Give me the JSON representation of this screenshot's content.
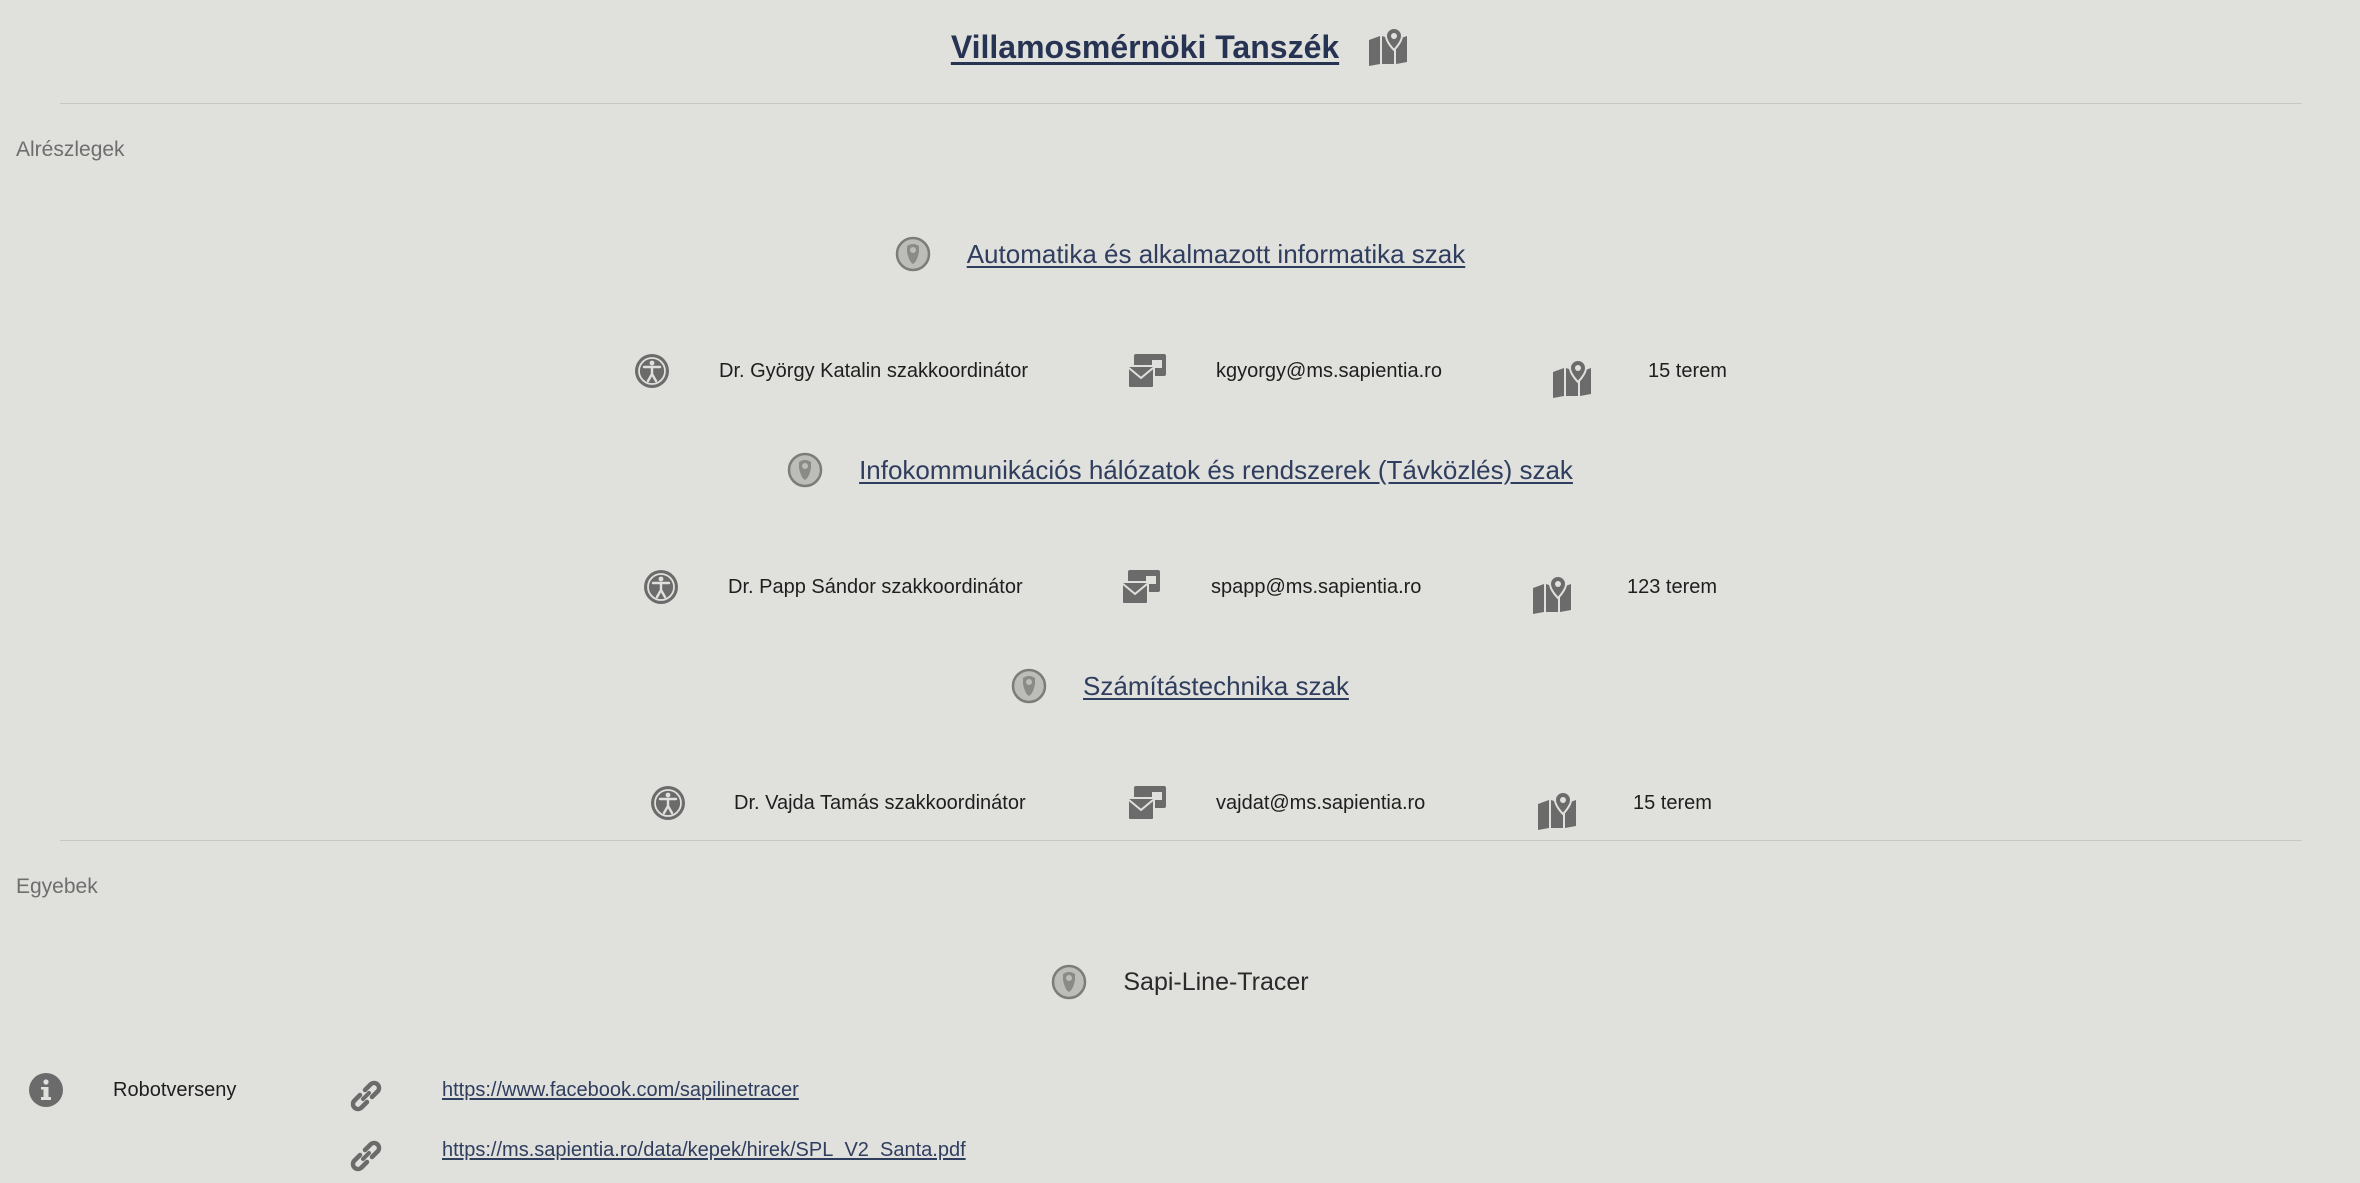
{
  "header": {
    "title": "Villamosmérnöki Tanszék",
    "map_icon": "map-location-icon"
  },
  "sections": {
    "subunits_label": "Alrészlegek",
    "other_label": "Egyebek"
  },
  "programs": [
    {
      "name": "Automatika és alkalmazott informatika szak",
      "coordinator": "Dr. György Katalin szakkoordinátor",
      "email": "kgyorgy@ms.sapientia.ro",
      "room": "15 terem"
    },
    {
      "name": "Infokommunikációs hálózatok és rendszerek (Távközlés) szak",
      "coordinator": "Dr. Papp Sándor szakkoordinátor",
      "email": "spapp@ms.sapientia.ro",
      "room": "123 terem"
    },
    {
      "name": "Számítástechnika szak",
      "coordinator": "Dr. Vajda Tamás szakkoordinátor",
      "email": "vajdat@ms.sapientia.ro",
      "room": "15 terem"
    }
  ],
  "other": {
    "title": "Sapi-Line-Tracer",
    "description": "Robotverseny",
    "links": [
      "https://www.facebook.com/sapilinetracer",
      "https://ms.sapientia.ro/data/kepek/hirek/SPL_V2_Santa.pdf"
    ]
  },
  "colors": {
    "background": "#e0e0dc",
    "link": "#2f3d5e",
    "icon": "#6b6b6b"
  }
}
